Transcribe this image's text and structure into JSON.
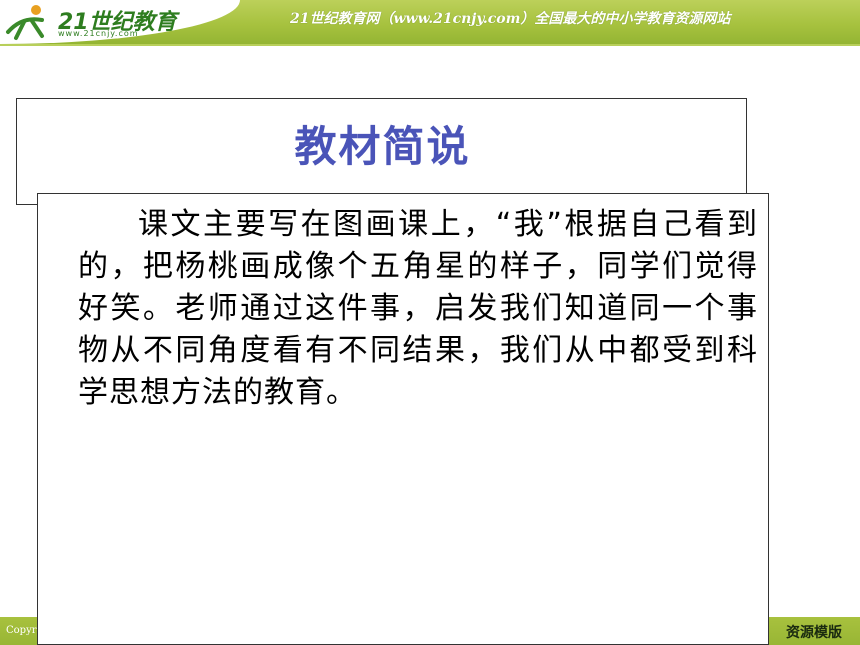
{
  "header": {
    "logo_text": "21世纪教育",
    "logo_url": "www.21cnjy.com",
    "tagline": "21世纪教育网（www.21cnjy.com）全国最大的中小学教育资源网站"
  },
  "slide": {
    "title": "教材简说",
    "body": "课文主要写在图画课上，“我”根据自己看到的，把杨桃画成像个五角星的样子，同学们觉得好笑。老师通过这件事，启发我们知道同一个事物从不同角度看有不同结果，我们从中都受到科学思想方法的教育。"
  },
  "footer": {
    "copyright": "Copyr",
    "right_text": "资源模版"
  },
  "colors": {
    "title": "#4a54b8",
    "banner_green": "#a7c23f",
    "logo_green": "#2e7d1f"
  }
}
